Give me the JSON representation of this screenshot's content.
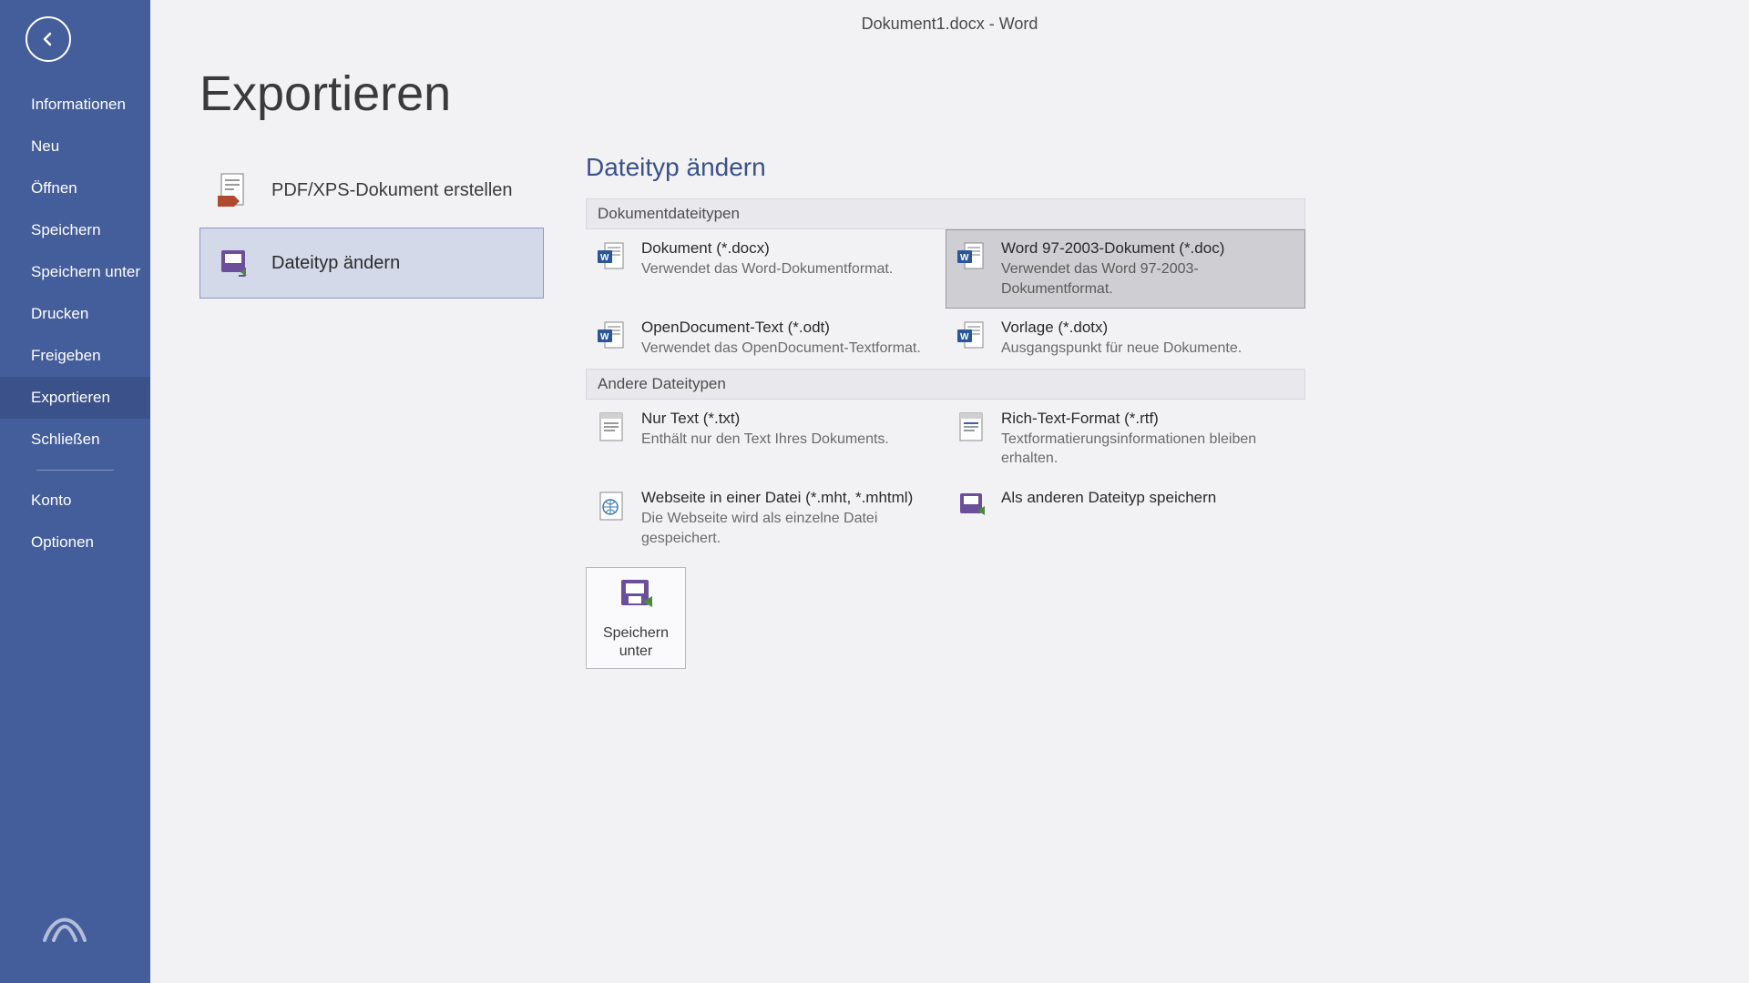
{
  "window_title": "Dokument1.docx - Word",
  "sidebar": {
    "items": [
      "Informationen",
      "Neu",
      "Öffnen",
      "Speichern",
      "Speichern unter",
      "Drucken",
      "Freigeben",
      "Exportieren",
      "Schließen"
    ],
    "after_sep": [
      "Konto",
      "Optionen"
    ],
    "active_index": 7
  },
  "page_title": "Exportieren",
  "export_options": [
    {
      "label": "PDF/XPS-Dokument erstellen",
      "icon": "pdf-xps"
    },
    {
      "label": "Dateityp ändern",
      "icon": "change-filetype"
    }
  ],
  "export_selected_index": 1,
  "detail": {
    "title": "Dateityp ändern",
    "groups": [
      {
        "header": "Dokumentdateitypen",
        "items": [
          {
            "name": "Dokument (*.docx)",
            "desc": "Verwendet das Word-Dokumentformat.",
            "icon": "word"
          },
          {
            "name": "Word 97-2003-Dokument (*.doc)",
            "desc": "Verwendet das Word 97-2003-Dokumentformat.",
            "icon": "word"
          },
          {
            "name": "OpenDocument-Text (*.odt)",
            "desc": "Verwendet das OpenDocument-Textformat.",
            "icon": "word"
          },
          {
            "name": "Vorlage (*.dotx)",
            "desc": "Ausgangspunkt für neue Dokumente.",
            "icon": "word"
          }
        ],
        "selected_index": 1
      },
      {
        "header": "Andere Dateitypen",
        "items": [
          {
            "name": "Nur Text (*.txt)",
            "desc": "Enthält nur den Text Ihres Dokuments.",
            "icon": "text"
          },
          {
            "name": "Rich-Text-Format (*.rtf)",
            "desc": "Textformatierungsinformationen bleiben erhalten.",
            "icon": "rtf"
          },
          {
            "name": "Webseite in einer Datei (*.mht, *.mhtml)",
            "desc": "Die Webseite wird als einzelne Datei gespeichert.",
            "icon": "web"
          },
          {
            "name": "Als anderen Dateityp speichern",
            "desc": "",
            "icon": "save"
          }
        ],
        "selected_index": -1
      }
    ],
    "save_as_button": "Speichern unter"
  }
}
